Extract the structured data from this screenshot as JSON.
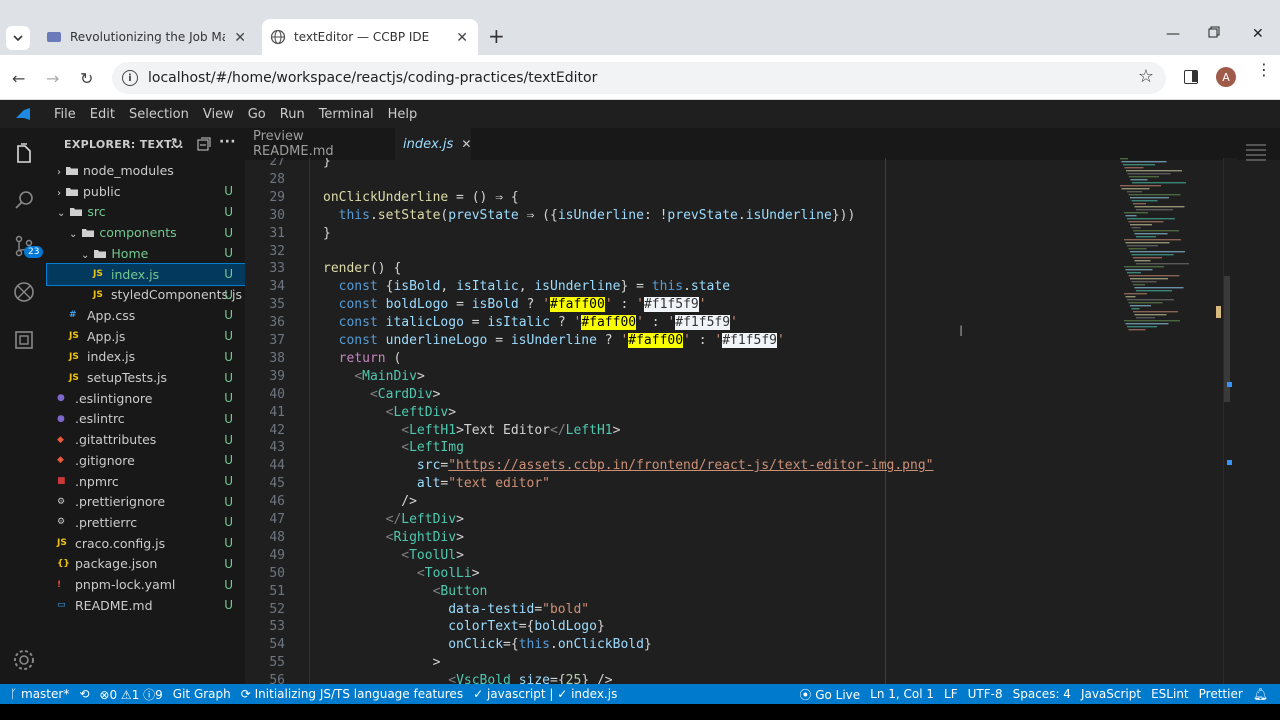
{
  "browser": {
    "tabs": [
      {
        "title": "Revolutionizing the Job Market"
      },
      {
        "title": "textEditor — CCBP IDE"
      }
    ],
    "url": "localhost/#/home/workspace/reactjs/coding-practices/textEditor",
    "profile_initial": "A"
  },
  "menu": [
    "File",
    "Edit",
    "Selection",
    "View",
    "Go",
    "Run",
    "Terminal",
    "Help"
  ],
  "activity": {
    "scm_badge": "23"
  },
  "explorer": {
    "title": "EXPLORER: TEXT...",
    "items": [
      {
        "name": "node_modules",
        "kind": "folder",
        "badge": ""
      },
      {
        "name": "public",
        "kind": "folder",
        "badge": "U"
      },
      {
        "name": "src",
        "kind": "folder-open",
        "badge": "U"
      },
      {
        "name": "components",
        "kind": "folder-open",
        "badge": "U"
      },
      {
        "name": "Home",
        "kind": "folder-open",
        "badge": "U"
      },
      {
        "name": "index.js",
        "kind": "js",
        "badge": "U"
      },
      {
        "name": "styledComponents.js",
        "kind": "js",
        "badge": "U"
      },
      {
        "name": "App.css",
        "kind": "css",
        "badge": "U"
      },
      {
        "name": "App.js",
        "kind": "js",
        "badge": "U"
      },
      {
        "name": "index.js",
        "kind": "js",
        "badge": "U"
      },
      {
        "name": "setupTests.js",
        "kind": "js",
        "badge": "U"
      },
      {
        "name": ".eslintignore",
        "kind": "eslint",
        "badge": "U"
      },
      {
        "name": ".eslintrc",
        "kind": "eslint",
        "badge": "U"
      },
      {
        "name": ".gitattributes",
        "kind": "git",
        "badge": "U"
      },
      {
        "name": ".gitignore",
        "kind": "git",
        "badge": "U"
      },
      {
        "name": ".npmrc",
        "kind": "npm",
        "badge": "U"
      },
      {
        "name": ".prettierignore",
        "kind": "gear",
        "badge": "U"
      },
      {
        "name": ".prettierrc",
        "kind": "gear",
        "badge": "U"
      },
      {
        "name": "craco.config.js",
        "kind": "js",
        "badge": "U"
      },
      {
        "name": "package.json",
        "kind": "json",
        "badge": "U"
      },
      {
        "name": "pnpm-lock.yaml",
        "kind": "yaml",
        "badge": "U"
      },
      {
        "name": "README.md",
        "kind": "md",
        "badge": "U"
      }
    ]
  },
  "editor_tabs": [
    {
      "label": "Preview README.md"
    },
    {
      "label": "index.js"
    }
  ],
  "code_lines": [
    {
      "n": "27",
      "code": "}"
    },
    {
      "n": "28",
      "code": ""
    },
    {
      "n": "29",
      "code": "onClickUnderline = () ⇒ {"
    },
    {
      "n": "30",
      "code": "  this.setState(prevState ⇒ ({isUnderline: !prevState.isUnderline}))"
    },
    {
      "n": "31",
      "code": "}"
    },
    {
      "n": "32",
      "code": ""
    },
    {
      "n": "33",
      "code": "render() {"
    },
    {
      "n": "34",
      "code": "  const {isBold, isItalic, isUnderline} = this.state"
    },
    {
      "n": "35",
      "code": "  const boldLogo = isBold ? '#faff00' : '#f1f5f9'"
    },
    {
      "n": "36",
      "code": "  const italicLogo = isItalic ? '#faff00' : '#f1f5f9'"
    },
    {
      "n": "37",
      "code": "  const underlineLogo = isUnderline ? '#faff00' : '#f1f5f9'"
    },
    {
      "n": "38",
      "code": "  return ("
    },
    {
      "n": "39",
      "code": "    <MainDiv>"
    },
    {
      "n": "40",
      "code": "      <CardDiv>"
    },
    {
      "n": "41",
      "code": "        <LeftDiv>"
    },
    {
      "n": "42",
      "code": "          <LeftH1>Text Editor</LeftH1>"
    },
    {
      "n": "43",
      "code": "          <LeftImg"
    },
    {
      "n": "44",
      "code": "            src=\"https://assets.ccbp.in/frontend/react-js/text-editor-img.png\""
    },
    {
      "n": "45",
      "code": "            alt=\"text editor\""
    },
    {
      "n": "46",
      "code": "          />"
    },
    {
      "n": "47",
      "code": "        </LeftDiv>"
    },
    {
      "n": "48",
      "code": "        <RightDiv>"
    },
    {
      "n": "49",
      "code": "          <ToolUl>"
    },
    {
      "n": "50",
      "code": "            <ToolLi>"
    },
    {
      "n": "51",
      "code": "              <Button"
    },
    {
      "n": "52",
      "code": "                data-testid=\"bold\""
    },
    {
      "n": "53",
      "code": "                colorText={boldLogo}"
    },
    {
      "n": "54",
      "code": "                onClick={this.onClickBold}"
    },
    {
      "n": "55",
      "code": "              >"
    },
    {
      "n": "56",
      "code": "                <VscBold size={25} />"
    }
  ],
  "status": {
    "branch": "master*",
    "errors": "0",
    "warnings": "1",
    "info": "9",
    "git_graph": "Git Graph",
    "ts": "Initializing JS/TS language features",
    "lang_crumb": "javascript",
    "file_crumb": "index.js",
    "go_live": "Go Live",
    "position": "Ln 1, Col 1",
    "eol": "LF",
    "encoding": "UTF-8",
    "spaces": "Spaces: 4",
    "language": "JavaScript",
    "eslint": "ESLint",
    "prettier": "Prettier"
  },
  "colors": {
    "accent": "#007acc",
    "editor_bg": "#1f1f1f",
    "highlight_yellow": "#faff00",
    "highlight_white": "#f1f5f9"
  }
}
